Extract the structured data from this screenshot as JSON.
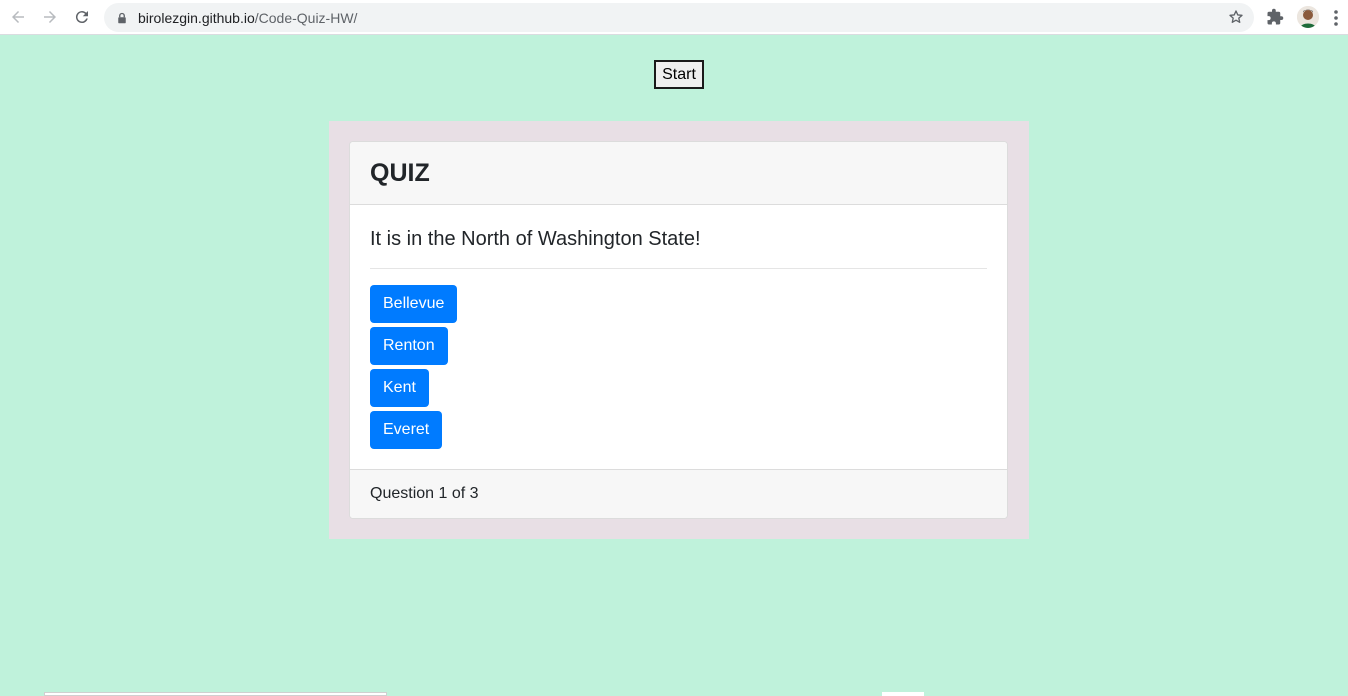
{
  "browser": {
    "url_host": "birolezgin.github.io",
    "url_path": "/Code-Quiz-HW/",
    "icons": {
      "back": "back-arrow-icon",
      "forward": "forward-arrow-icon",
      "reload": "reload-icon",
      "lock": "lock-icon",
      "star": "star-icon",
      "extensions": "puzzle-icon",
      "profile": "avatar",
      "menu": "kebab-menu-icon"
    }
  },
  "start_button": {
    "label": "Start"
  },
  "quiz": {
    "title": "QUIZ",
    "question": "It is in the North of Washington State!",
    "answers": [
      {
        "label": "Bellevue"
      },
      {
        "label": "Renton"
      },
      {
        "label": "Kent"
      },
      {
        "label": "Everet"
      }
    ],
    "progress": "Question 1 of 3"
  },
  "colors": {
    "page_background": "#bff2db",
    "quiz_frame": "#e8dfe5",
    "answer_button": "#007bff"
  }
}
